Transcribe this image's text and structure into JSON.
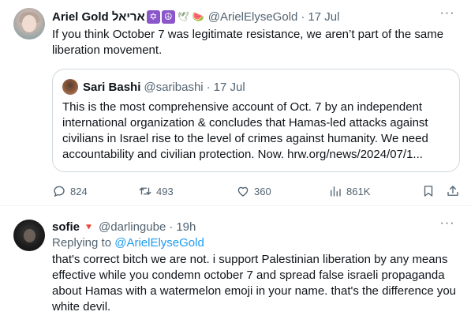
{
  "tweet1": {
    "author_name": "Ariel Gold אריאל",
    "emojis": [
      "✡",
      "☮",
      "🕊",
      "🍉"
    ],
    "handle": "@ArielElyseGold",
    "date": "17 Jul",
    "text": "If you think October 7 was legitimate resistance, we aren’t part of the same liberation movement.",
    "quote": {
      "author_name": "Sari Bashi",
      "handle": "@saribashi",
      "date": "17 Jul",
      "text": "This is the most comprehensive account of Oct. 7 by an independent international organization & concludes that Hamas-led attacks against civilians in Israel rise to the level of crimes against humanity. We need accountability and civilian protection. Now. hrw.org/news/2024/07/1..."
    },
    "actions": {
      "replies": "824",
      "reposts": "493",
      "likes": "360",
      "views": "861K"
    }
  },
  "tweet2": {
    "author_name": "sofie",
    "emoji": "🔻",
    "handle": "@darlingube",
    "time": "19h",
    "replying_prefix": "Replying to ",
    "replying_handle": "@ArielElyseGold",
    "text": "that's correct bitch we are not. i support Palestinian liberation by any means effective while you condemn october 7 and spread false israeli propaganda about Hamas with a watermelon emoji in your name. that's the difference you white devil."
  },
  "common": {
    "separator": "·",
    "more_label": "···"
  },
  "icons": {
    "reply": "reply-icon",
    "repost": "repost-icon",
    "like": "heart-icon",
    "views": "views-icon",
    "bookmark": "bookmark-icon",
    "share": "share-icon",
    "more": "more-icon"
  },
  "colors": {
    "text": "#0f1419",
    "muted": "#536471",
    "link": "#1d9bf0",
    "border": "#cfd9de"
  }
}
